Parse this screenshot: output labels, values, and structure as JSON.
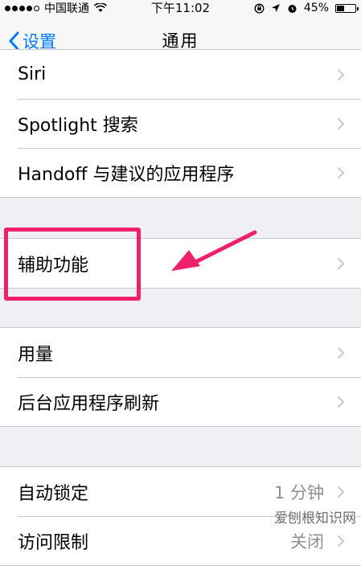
{
  "status_bar": {
    "carrier": "中国联通",
    "time": "下午11:02",
    "battery_percent": "45%",
    "battery_level": 0.45
  },
  "nav": {
    "back_label": "设置",
    "title": "通用"
  },
  "groups": [
    {
      "items": [
        {
          "label": "Siri"
        },
        {
          "label": "Spotlight 搜索"
        },
        {
          "label": "Handoff 与建议的应用程序"
        }
      ]
    },
    {
      "items": [
        {
          "label": "辅助功能"
        }
      ]
    },
    {
      "items": [
        {
          "label": "用量"
        },
        {
          "label": "后台应用程序刷新"
        }
      ]
    },
    {
      "items": [
        {
          "label": "自动锁定",
          "value": "1 分钟"
        },
        {
          "label": "访问限制",
          "value": "关闭"
        }
      ]
    }
  ],
  "watermark": "爱刨根知识网",
  "colors": {
    "accent": "#007aff",
    "highlight": "#f0216b",
    "background": "#efeff4"
  }
}
